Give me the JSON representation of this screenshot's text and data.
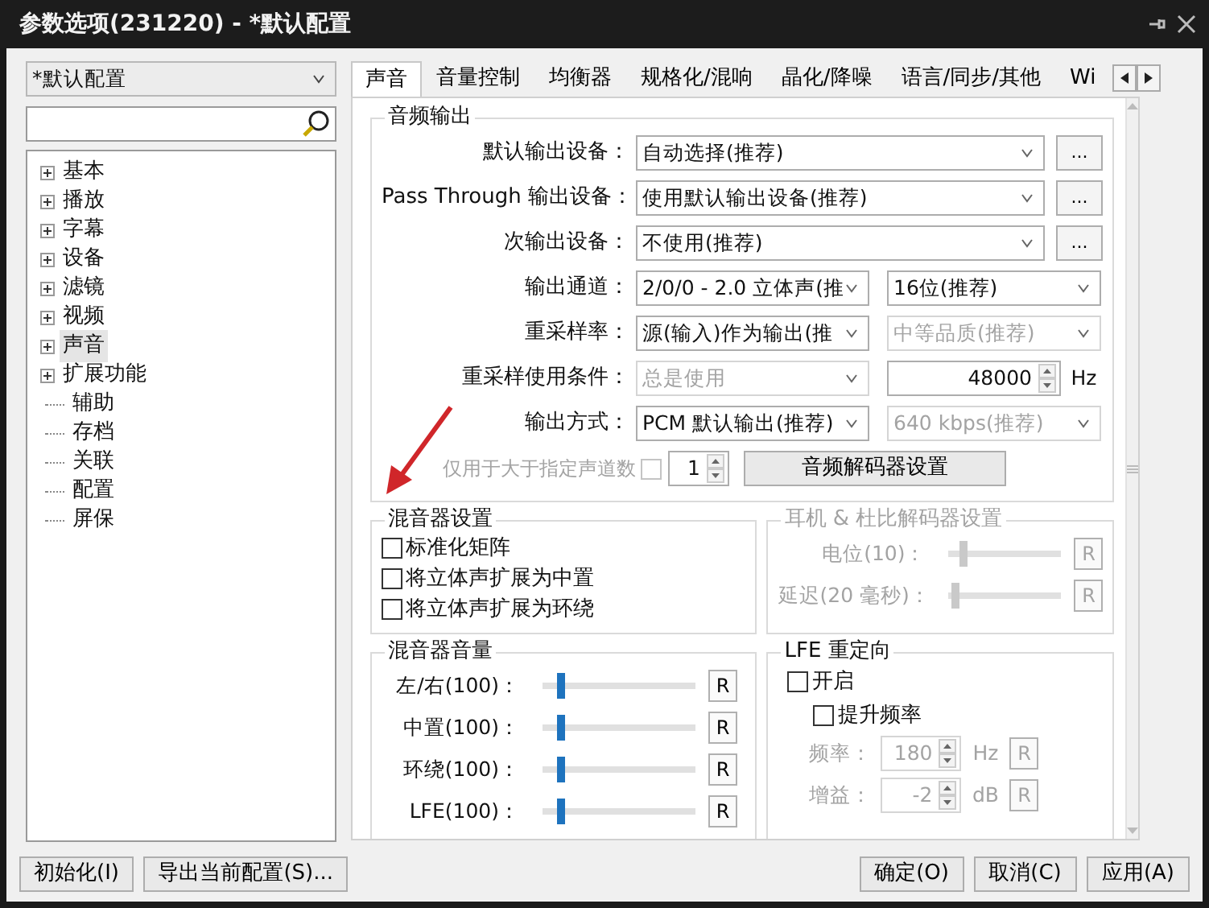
{
  "window": {
    "title": "参数选项(231220) - *默认配置"
  },
  "profile": {
    "value": "*默认配置"
  },
  "tree": [
    {
      "label": "基本",
      "expandable": true,
      "selected": false
    },
    {
      "label": "播放",
      "expandable": true,
      "selected": false
    },
    {
      "label": "字幕",
      "expandable": true,
      "selected": false
    },
    {
      "label": "设备",
      "expandable": true,
      "selected": false
    },
    {
      "label": "滤镜",
      "expandable": true,
      "selected": false
    },
    {
      "label": "视频",
      "expandable": true,
      "selected": false
    },
    {
      "label": "声音",
      "expandable": true,
      "selected": true
    },
    {
      "label": "扩展功能",
      "expandable": true,
      "selected": false
    },
    {
      "label": "辅助",
      "expandable": false,
      "selected": false
    },
    {
      "label": "存档",
      "expandable": false,
      "selected": false
    },
    {
      "label": "关联",
      "expandable": false,
      "selected": false
    },
    {
      "label": "配置",
      "expandable": false,
      "selected": false
    },
    {
      "label": "屏保",
      "expandable": false,
      "selected": false
    }
  ],
  "tabs": [
    {
      "label": "声音",
      "selected": true
    },
    {
      "label": "音量控制",
      "selected": false
    },
    {
      "label": "均衡器",
      "selected": false
    },
    {
      "label": "规格化/混响",
      "selected": false
    },
    {
      "label": "晶化/降噪",
      "selected": false
    },
    {
      "label": "语言/同步/其他",
      "selected": false
    },
    {
      "label": "Wi",
      "selected": false
    }
  ],
  "audio_output": {
    "title": "音频输出",
    "rows": [
      {
        "kind": "device",
        "label": "默认输出设备：",
        "value": "自动选择(推荐)",
        "button": "..."
      },
      {
        "kind": "device",
        "label": "Pass Through 输出设备：",
        "value": "使用默认输出设备(推荐)",
        "button": "..."
      },
      {
        "kind": "device",
        "label": "次输出设备：",
        "value": "不使用(推荐)",
        "button": "..."
      },
      {
        "kind": "pair",
        "label": "输出通道：",
        "left": {
          "value": "2/0/0 - 2.0 立体声(推",
          "disabled": false
        },
        "right": {
          "kind": "select",
          "value": "16位(推荐)",
          "disabled": false
        }
      },
      {
        "kind": "pair",
        "label": "重采样率：",
        "left": {
          "value": "源(输入)作为输出(推",
          "disabled": false
        },
        "right": {
          "kind": "select",
          "value": "中等品质(推荐)",
          "disabled": true
        }
      },
      {
        "kind": "pair",
        "label": "重采样使用条件：",
        "left": {
          "value": "总是使用",
          "disabled": true
        },
        "right": {
          "kind": "spinner",
          "value": "48000",
          "unit": "Hz",
          "disabled": false
        }
      },
      {
        "kind": "pair",
        "label": "输出方式：",
        "left": {
          "value": "PCM 默认输出(推荐)",
          "disabled": false
        },
        "right": {
          "kind": "select",
          "value": "640 kbps(推荐)",
          "disabled": true
        }
      },
      {
        "kind": "option",
        "label": "仅用于大于指定声道数",
        "checked": false,
        "disabled": true,
        "spinner": "1",
        "button": "音频解码器设置"
      }
    ]
  },
  "mixer_settings": {
    "title": "混音器设置",
    "options": [
      {
        "label": "标准化矩阵",
        "checked": false
      },
      {
        "label": "将立体声扩展为中置",
        "checked": false
      },
      {
        "label": "将立体声扩展为环绕",
        "checked": false
      }
    ]
  },
  "headphone": {
    "title": "耳机 & 杜比解码器设置",
    "disabled": true,
    "sliders": [
      {
        "label": "电位(10)：",
        "level": 0.1,
        "reset": "R"
      },
      {
        "label": "延迟(20 毫秒)：",
        "level": 0.02,
        "reset": "R"
      }
    ]
  },
  "mixer_volume": {
    "title": "混音器音量",
    "sliders": [
      {
        "label": "左/右(100)：",
        "level": 0.1,
        "reset": "R"
      },
      {
        "label": "中置(100)：",
        "level": 0.1,
        "reset": "R"
      },
      {
        "label": "环绕(100)：",
        "level": 0.1,
        "reset": "R"
      },
      {
        "label": "LFE(100)：",
        "level": 0.1,
        "reset": "R"
      }
    ]
  },
  "lfe": {
    "title": "LFE 重定向",
    "options": [
      {
        "label": "开启",
        "checked": false,
        "children": [
          {
            "label": "提升频率",
            "checked": false
          }
        ]
      }
    ],
    "fields": [
      {
        "label": "频率：",
        "value": "180",
        "unit": "Hz",
        "reset": "R",
        "disabled": true
      },
      {
        "label": "增益：",
        "value": "-2",
        "unit": "dB",
        "reset": "R",
        "disabled": true
      }
    ]
  },
  "footer": {
    "left_buttons": [
      "初始化(I)",
      "导出当前配置(S)..."
    ],
    "right_buttons": [
      "确定(O)",
      "取消(C)",
      "应用(A)"
    ]
  }
}
